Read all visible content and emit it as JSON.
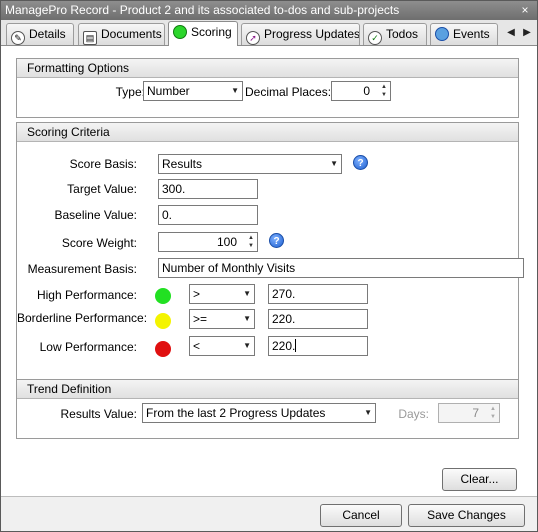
{
  "window": {
    "title": "ManagePro Record - Product 2 and its associated to-dos and sub-projects",
    "close_glyph": "×"
  },
  "tabs": [
    {
      "label": "Details",
      "icon": "pencil-icon",
      "active": false
    },
    {
      "label": "Documents",
      "icon": "document-icon",
      "active": false
    },
    {
      "label": "Scoring",
      "icon": "green-circle-icon",
      "active": true
    },
    {
      "label": "Progress Updates",
      "icon": "progress-arrow-icon",
      "active": false
    },
    {
      "label": "Todos",
      "icon": "checkmark-icon",
      "active": false
    },
    {
      "label": "Events",
      "icon": "globe-icon",
      "active": false
    }
  ],
  "tab_scroll": {
    "left": "◀",
    "right": "▶"
  },
  "formatting": {
    "header": "Formatting Options",
    "type_label": "Type:",
    "type_value": "Number",
    "decimal_label": "Decimal Places:",
    "decimal_value": "0"
  },
  "scoring": {
    "header": "Scoring Criteria",
    "score_basis_label": "Score Basis:",
    "score_basis_value": "Results",
    "target_label": "Target Value:",
    "target_value": "300.",
    "baseline_label": "Baseline Value:",
    "baseline_value": "0.",
    "weight_label": "Score Weight:",
    "weight_value": "100",
    "measurement_label": "Measurement Basis:",
    "measurement_value": "Number of Monthly Visits",
    "help_glyph": "?",
    "performance": [
      {
        "label": "High Performance:",
        "color": "#22e022",
        "operator": ">",
        "value": "270."
      },
      {
        "label": "Borderline Performance:",
        "color": "#f4f400",
        "operator": ">=",
        "value": "220."
      },
      {
        "label": "Low Performance:",
        "color": "#e01010",
        "operator": "<",
        "value": "220."
      }
    ]
  },
  "trend": {
    "header": "Trend Definition",
    "results_label": "Results Value:",
    "results_value": "From the last 2 Progress Updates",
    "days_label": "Days:",
    "days_value": "7"
  },
  "buttons": {
    "clear": "Clear...",
    "cancel": "Cancel",
    "save": "Save Changes"
  }
}
